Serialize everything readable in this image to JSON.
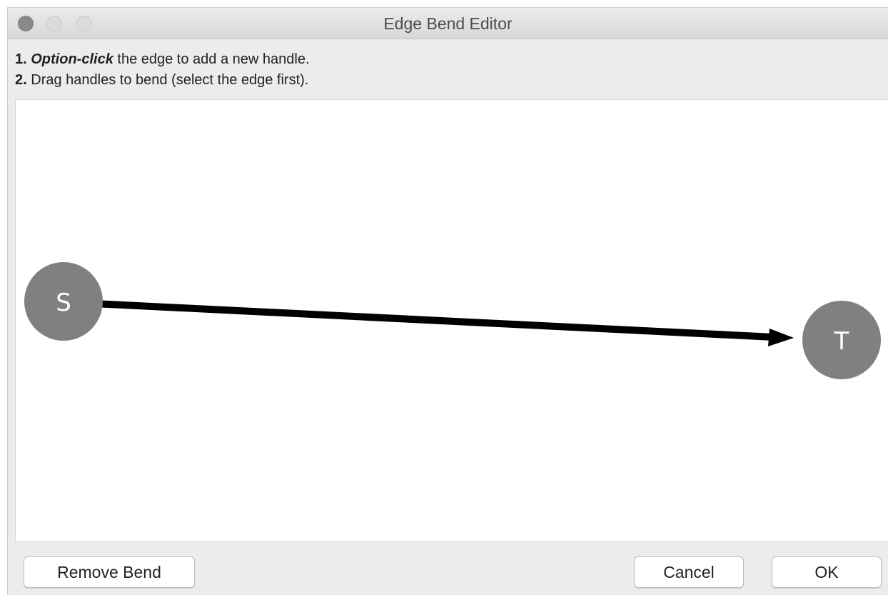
{
  "window": {
    "title": "Edge Bend Editor"
  },
  "instructions": {
    "step1_number": "1.",
    "step1_emphasis": "Option-click",
    "step1_rest": " the edge to add a new handle.",
    "step2_number": "2.",
    "step2_text": " Drag handles to bend (select the edge first)."
  },
  "graph": {
    "source_label": "S",
    "target_label": "T",
    "node_color": "#808080",
    "edge_color": "#000000"
  },
  "buttons": {
    "remove_bend": "Remove Bend",
    "cancel": "Cancel",
    "ok": "OK"
  }
}
